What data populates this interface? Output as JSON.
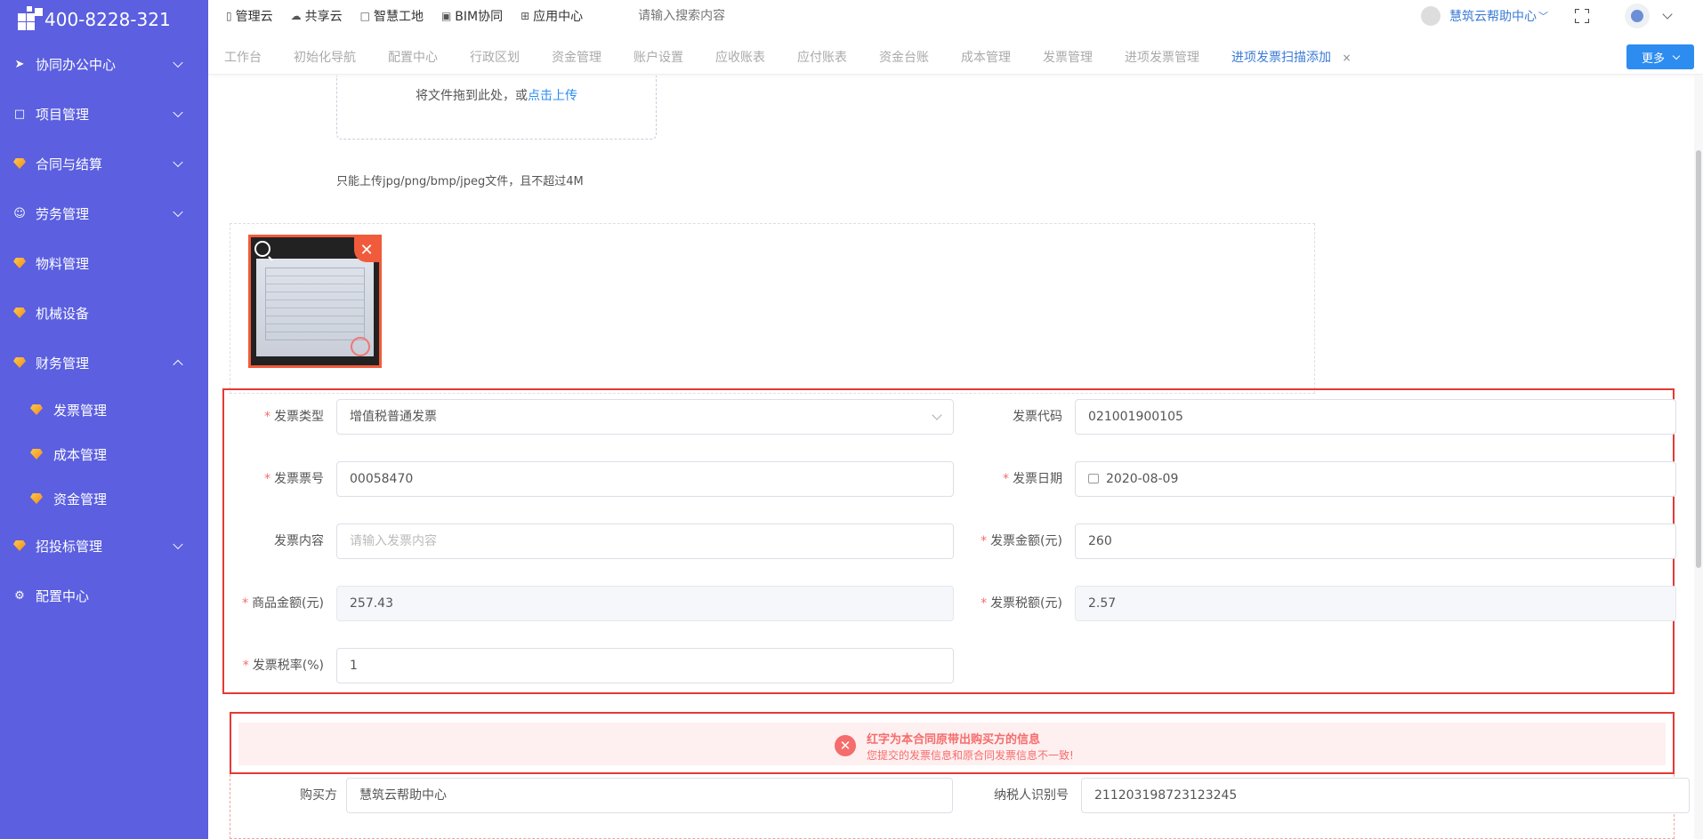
{
  "sidebar": {
    "phone": "400-8228-321",
    "items": [
      {
        "label": "协同办公中心"
      },
      {
        "label": "项目管理"
      },
      {
        "label": "合同与结算"
      },
      {
        "label": "劳务管理"
      },
      {
        "label": "物料管理"
      },
      {
        "label": "机械设备"
      },
      {
        "label": "财务管理"
      },
      {
        "label": "招投标管理"
      },
      {
        "label": "配置中心"
      }
    ],
    "sub_items": [
      {
        "label": "发票管理"
      },
      {
        "label": "成本管理"
      },
      {
        "label": "资金管理"
      }
    ]
  },
  "topbar": {
    "nav": [
      {
        "label": "管理云"
      },
      {
        "label": "共享云"
      },
      {
        "label": "智慧工地"
      },
      {
        "label": "BIM协同"
      },
      {
        "label": "应用中心"
      }
    ],
    "search_placeholder": "请输入搜索内容",
    "help_label": "慧筑云帮助中心",
    "help_arrow": "﹀"
  },
  "tabs": {
    "items": [
      {
        "label": "工作台"
      },
      {
        "label": "初始化导航"
      },
      {
        "label": "配置中心"
      },
      {
        "label": "行政区划"
      },
      {
        "label": "资金管理"
      },
      {
        "label": "账户设置"
      },
      {
        "label": "应收账表"
      },
      {
        "label": "应付账表"
      },
      {
        "label": "资金台账"
      },
      {
        "label": "成本管理"
      },
      {
        "label": "发票管理"
      },
      {
        "label": "进项发票管理"
      },
      {
        "label": "进项发票扫描添加"
      }
    ],
    "close_glyph": "×",
    "more_label": "更多"
  },
  "upload": {
    "drag_text": "将文件拖到此处，或",
    "upload_link": "点击上传",
    "tip": "只能上传jpg/png/bmp/jpeg文件，且不超过4M"
  },
  "form": {
    "invoice_type_label": "发票类型",
    "invoice_type_value": "增值税普通发票",
    "invoice_code_label": "发票代码",
    "invoice_code_value": "021001900105",
    "invoice_no_label": "发票票号",
    "invoice_no_value": "00058470",
    "invoice_date_label": "发票日期",
    "invoice_date_value": "2020-08-09",
    "content_label": "发票内容",
    "content_placeholder": "请输入发票内容",
    "amount_label": "发票金额(元)",
    "amount_value": "260",
    "goods_amount_label": "商品金额(元)",
    "goods_amount_value": "257.43",
    "tax_label": "发票税额(元)",
    "tax_value": "2.57",
    "tax_rate_label": "发票税率(%)",
    "tax_rate_value": "1"
  },
  "alert": {
    "title": "红字为本合同原带出购买方的信息",
    "desc": "您提交的发票信息和原合同发票信息不一致!"
  },
  "buyer": {
    "buyer_label": "购买方",
    "buyer_value": "慧筑云帮助中心",
    "taxpayer_label": "纳税人识别号",
    "taxpayer_value": "211203198723123245"
  },
  "colors": {
    "sidebar_bg": "#5b5fe0",
    "accent": "#2d8cf0",
    "error": "#e53935"
  }
}
